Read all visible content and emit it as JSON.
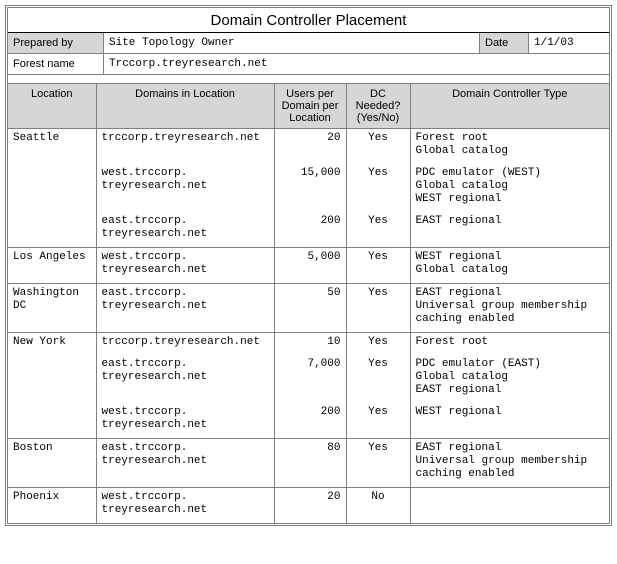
{
  "title": "Domain Controller Placement",
  "meta": {
    "prepared_by_label": "Prepared by",
    "prepared_by": "Site Topology Owner",
    "date_label": "Date",
    "date": "1/1/03",
    "forest_label": "Forest name",
    "forest": "Trccorp.treyresearch.net"
  },
  "columns": {
    "location": "Location",
    "domains": "Domains in Location",
    "users": "Users per Domain per Location",
    "needed": "DC Needed? (Yes/No)",
    "dctype": "Domain Controller Type"
  },
  "rows": [
    {
      "loc": "Seattle",
      "domain": "trccorp.treyresearch.net",
      "users": "20",
      "needed": "Yes",
      "types": [
        "Forest root",
        "Global catalog"
      ]
    },
    {
      "loc": "",
      "domain": "west.trccorp.treyresearch.net",
      "users": "15,000",
      "needed": "Yes",
      "types": [
        "PDC emulator (WEST)",
        "Global catalog",
        "WEST regional"
      ]
    },
    {
      "loc": "",
      "domain": "east.trccorp.treyresearch.net",
      "users": "200",
      "needed": "Yes",
      "types": [
        "EAST regional"
      ]
    },
    {
      "loc": "Los Angeles",
      "domain": "west.trccorp.treyresearch.net",
      "users": "5,000",
      "needed": "Yes",
      "types": [
        "WEST regional",
        "Global catalog"
      ]
    },
    {
      "loc": "Washington DC",
      "domain": "east.trccorp.treyresearch.net",
      "users": "50",
      "needed": "Yes",
      "types": [
        "EAST regional",
        "Universal group membership caching enabled"
      ]
    },
    {
      "loc": "New York",
      "domain": "trccorp.treyresearch.net",
      "users": "10",
      "needed": "Yes",
      "types": [
        "Forest root"
      ]
    },
    {
      "loc": "",
      "domain": "east.trccorp.treyresearch.net",
      "users": "7,000",
      "needed": "Yes",
      "types": [
        "PDC emulator (EAST)",
        "Global catalog",
        "EAST regional"
      ]
    },
    {
      "loc": "",
      "domain": "west.trccorp.treyresearch.net",
      "users": "200",
      "needed": "Yes",
      "types": [
        "WEST regional"
      ]
    },
    {
      "loc": "Boston",
      "domain": "east.trccorp.treyresearch.net",
      "users": "80",
      "needed": "Yes",
      "types": [
        "EAST regional",
        "Universal group membership caching enabled"
      ]
    },
    {
      "loc": "Phoenix",
      "domain": "west.trccorp.treyresearch.net",
      "users": "20",
      "needed": "No",
      "types": [
        ""
      ]
    }
  ]
}
